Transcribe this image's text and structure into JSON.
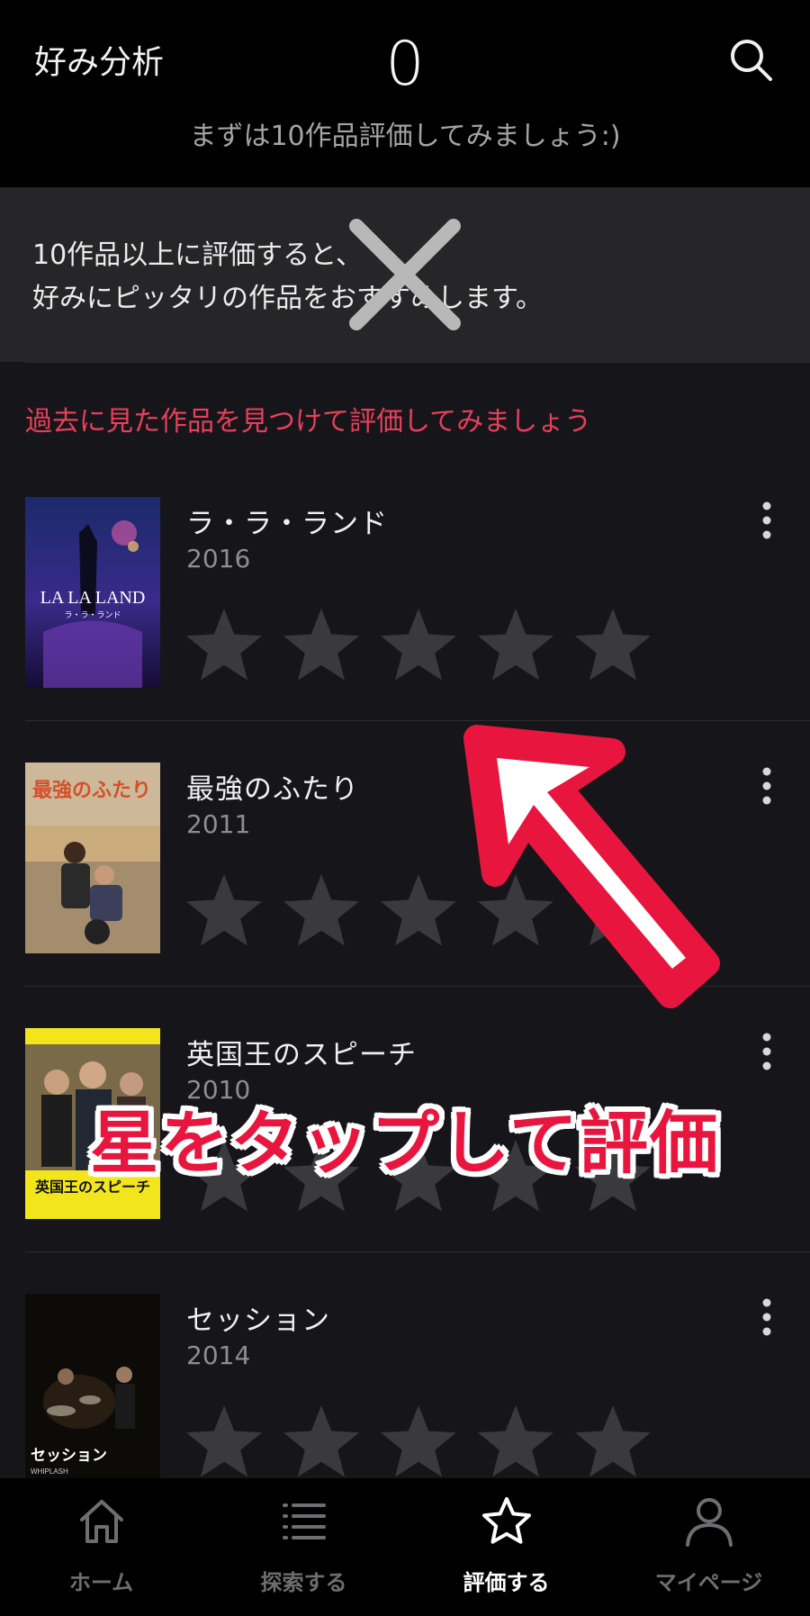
{
  "header": {
    "title": "好み分析",
    "count": "0",
    "subtitle": "まずは10作品評価してみましょう:)"
  },
  "notice": {
    "line1": "10作品以上に評価すると、",
    "line2": "好みにピッタリの作品をおすすめします。"
  },
  "prompt": "過去に見た作品を見つけて評価してみましょう",
  "movies": [
    {
      "title": "ラ・ラ・ランド",
      "year": "2016",
      "rating": 0,
      "poster_text": "LA LA LAND",
      "poster_sub": "ラ・ラ・ランド"
    },
    {
      "title": "最強のふたり",
      "year": "2011",
      "rating": 0,
      "poster_text": "最強のふたり"
    },
    {
      "title": "英国王のスピーチ",
      "year": "2010",
      "rating": 0,
      "poster_text": "英国王のスピーチ"
    },
    {
      "title": "セッション",
      "year": "2014",
      "rating": 0,
      "poster_text": "セッション",
      "poster_sub": "WHIPLASH"
    }
  ],
  "overlay": {
    "caption": "星をタップして評価"
  },
  "tabs": [
    {
      "label": "ホーム",
      "icon": "home-icon"
    },
    {
      "label": "探索する",
      "icon": "list-icon"
    },
    {
      "label": "評価する",
      "icon": "star-icon",
      "active": true
    },
    {
      "label": "マイページ",
      "icon": "person-icon"
    }
  ],
  "colors": {
    "accent": "#e83f5c",
    "background": "#16161a",
    "header": "#000000",
    "star_empty": "#3a3a3e"
  }
}
